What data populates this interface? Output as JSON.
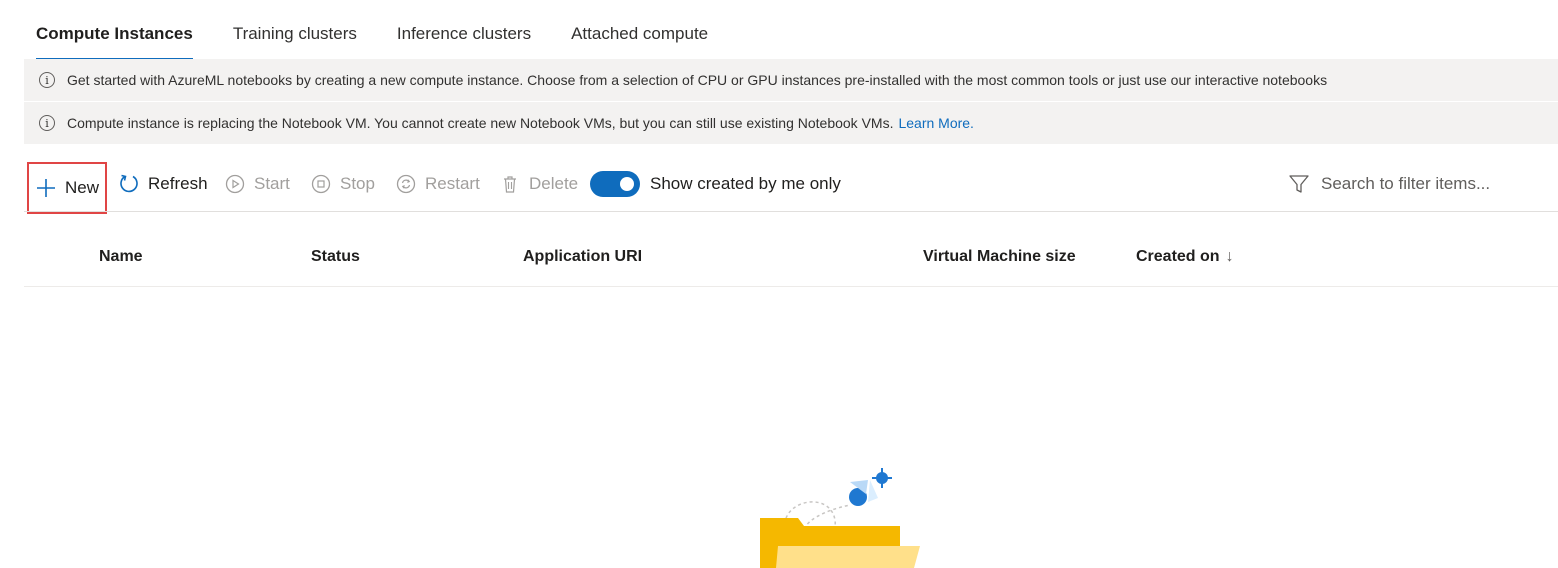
{
  "tabs": [
    {
      "label": "Compute Instances",
      "active": true
    },
    {
      "label": "Training clusters",
      "active": false
    },
    {
      "label": "Inference clusters",
      "active": false
    },
    {
      "label": "Attached compute",
      "active": false
    }
  ],
  "banners": [
    {
      "icon": "info-icon",
      "text": "Get started with AzureML notebooks by creating a new compute instance. Choose from a selection of CPU or GPU instances pre-installed with the most common tools or just use our interactive notebooks"
    },
    {
      "icon": "info-icon",
      "text": "Compute instance is replacing the Notebook VM. You cannot create new Notebook VMs, but you can still use existing Notebook VMs.",
      "link": "Learn More."
    }
  ],
  "toolbar": {
    "new_label": "New",
    "refresh_label": "Refresh",
    "start_label": "Start",
    "stop_label": "Stop",
    "restart_label": "Restart",
    "delete_label": "Delete",
    "toggle_label": "Show created by me only",
    "toggle_on": true,
    "search_placeholder": "Search to filter items..."
  },
  "table": {
    "columns": [
      "Name",
      "Status",
      "Application URI",
      "Virtual Machine size",
      "Created on"
    ],
    "sort_indicator": "↓",
    "rows": []
  },
  "colors": {
    "accent": "#0f6cbd",
    "highlight_border": "#e04545",
    "banner_bg": "#f3f2f1",
    "disabled_text": "#a19f9d"
  }
}
